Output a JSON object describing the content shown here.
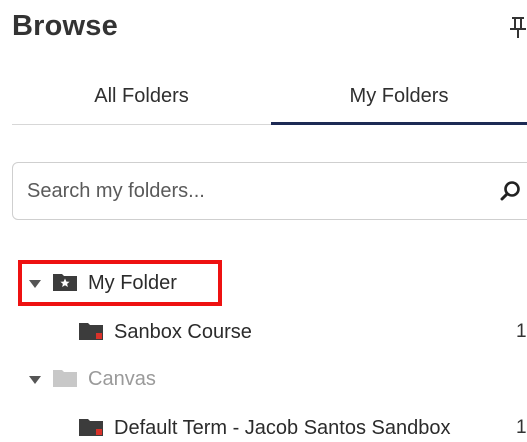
{
  "header": {
    "title": "Browse",
    "pin_icon": "pin-icon"
  },
  "tabs": [
    {
      "label": "All Folders",
      "selected": false
    },
    {
      "label": "My Folders",
      "selected": true
    }
  ],
  "search": {
    "placeholder": "Search my folders...",
    "value": "",
    "icon": "search-icon"
  },
  "tree": {
    "my_folder": {
      "label": "My Folder",
      "expanded": true,
      "icon": "starred-folder-icon",
      "highlighted": true
    },
    "sanbox_course": {
      "label": "Sanbox Course",
      "count": "1",
      "icon": "folder-icon"
    },
    "canvas": {
      "label": "Canvas",
      "expanded": true,
      "icon": "folder-icon"
    },
    "default_term": {
      "label": "Default Term - Jacob Santos Sandbox",
      "count": "1",
      "icon": "folder-icon"
    }
  },
  "colors": {
    "tab_underline": "#1d2a54",
    "highlight_box": "#ee1111",
    "folder_dark": "#3c3c3c",
    "folder_light": "#c8c8c8",
    "folder_marker": "#d9322a"
  }
}
